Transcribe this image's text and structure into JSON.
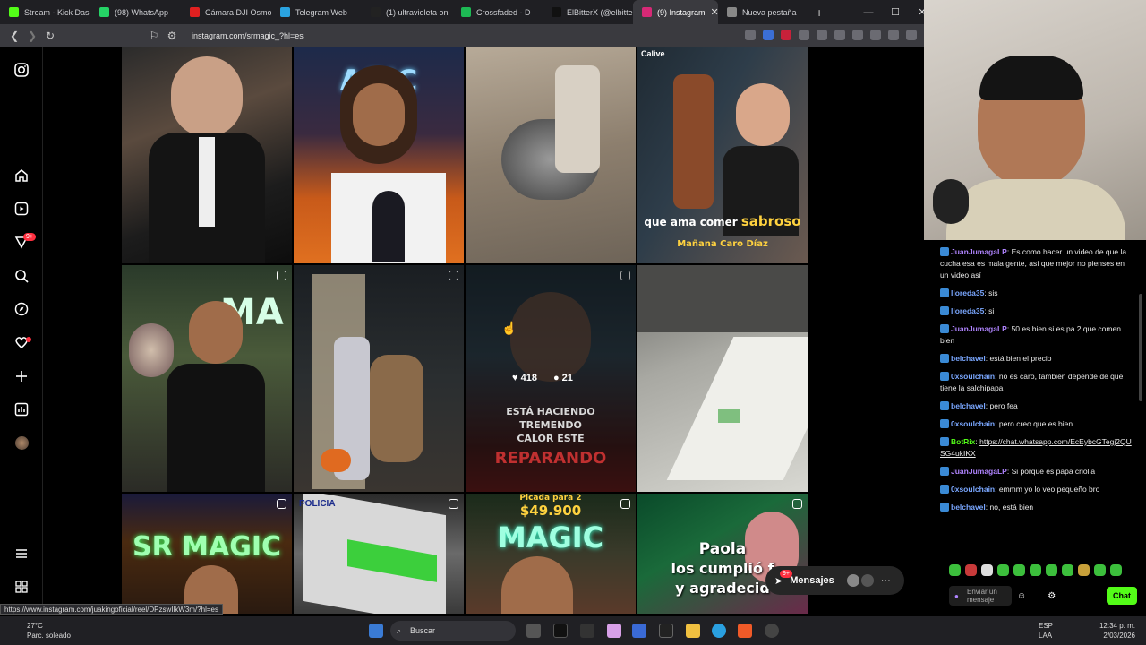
{
  "browser": {
    "tabs": [
      {
        "label": "Stream - Kick Dash",
        "color": "#53fc18"
      },
      {
        "label": "(98) WhatsApp",
        "color": "#25d366"
      },
      {
        "label": "Cámara DJI Osmo",
        "color": "#e02020"
      },
      {
        "label": "Telegram Web",
        "color": "#2aa3e0"
      },
      {
        "label": "(1) ultravioleta on",
        "color": "#222222"
      },
      {
        "label": "Crossfaded - D",
        "color": "#1db954"
      },
      {
        "label": "ElBitterX (@elbitte",
        "color": "#111111"
      },
      {
        "label": "(9) Instagram",
        "color": "#d62976",
        "active": true
      },
      {
        "label": "Nueva pestaña",
        "color": "#888888"
      }
    ],
    "url": "instagram.com/srmagic_?hl=es",
    "status_url": "https://www.instagram.com/juakingoficial/reel/DPzswIlkW3m/?hl=es"
  },
  "instagram": {
    "notification_badge": "9+",
    "messages_label": "Mensajes",
    "messages_badge": "9+",
    "grid_texts": {
      "cell4_line1": "que ama comer",
      "cell4_line1b": "sabroso",
      "cell4_line2": "Mañana Caro Díaz",
      "cell4_tag": "Calive",
      "cell7_likes": "418",
      "cell7_comments": "21",
      "cell7_caption1": "ESTÁ HACIENDO",
      "cell7_caption2": "TREMENDO",
      "cell7_caption3": "CALOR ESTE",
      "cell7_caption4": "REPARANDO",
      "cell9_sign": "SR MAGIC",
      "cell10_sign": "POLICIA",
      "cell11_price_label": "Picada para 2",
      "cell11_price": "$49.900",
      "cell11_sign": "MAGIC",
      "cell12_line1": "Paola",
      "cell12_line2": "los cumplió f",
      "cell12_line3": "y agradecid"
    }
  },
  "chat": {
    "messages": [
      {
        "user": "JuanJumagaLP",
        "text": "Es como hacer un video de que la cucha esa es mala gente, así que mejor no pienses en un video así",
        "color": "#b084ff"
      },
      {
        "user": "lloreda35",
        "text": "sis",
        "color": "#7aa7ff"
      },
      {
        "user": "lloreda35",
        "text": "si",
        "color": "#7aa7ff"
      },
      {
        "user": "JuanJumagaLP",
        "text": "50 es bien si es pa 2 que comen bien",
        "color": "#b084ff"
      },
      {
        "user": "belchavel",
        "text": "está bien el precio",
        "color": "#7aa7ff"
      },
      {
        "user": "0xsoulchain",
        "text": "no es caro, también depende de que tiene la salchipapa",
        "color": "#7aa7ff"
      },
      {
        "user": "belchavel",
        "text": "pero fea",
        "color": "#7aa7ff"
      },
      {
        "user": "0xsoulchain",
        "text": "pero creo que es bien",
        "color": "#7aa7ff"
      },
      {
        "user": "BotRix",
        "text": "https://chat.whatsapp.com/EcEybcGTegj2QUSG4ukIKX",
        "color": "#53fc18"
      },
      {
        "user": "JuanJumagaLP",
        "text": "Si porque es papa criolla",
        "color": "#b084ff"
      },
      {
        "user": "0xsoulchain",
        "text": "emmm yo lo veo pequeño bro",
        "color": "#7aa7ff"
      },
      {
        "user": "belchavel",
        "text": "no, está bien",
        "color": "#7aa7ff"
      }
    ],
    "input_placeholder": "Enviar un mensaje",
    "send_label": "Chat"
  },
  "taskbar": {
    "temp": "27°C",
    "weather": "Parc. soleado",
    "search_label": "Buscar",
    "lang1": "ESP",
    "lang2": "LAA",
    "time": "12:34 p. m.",
    "date": "2/03/2026"
  }
}
